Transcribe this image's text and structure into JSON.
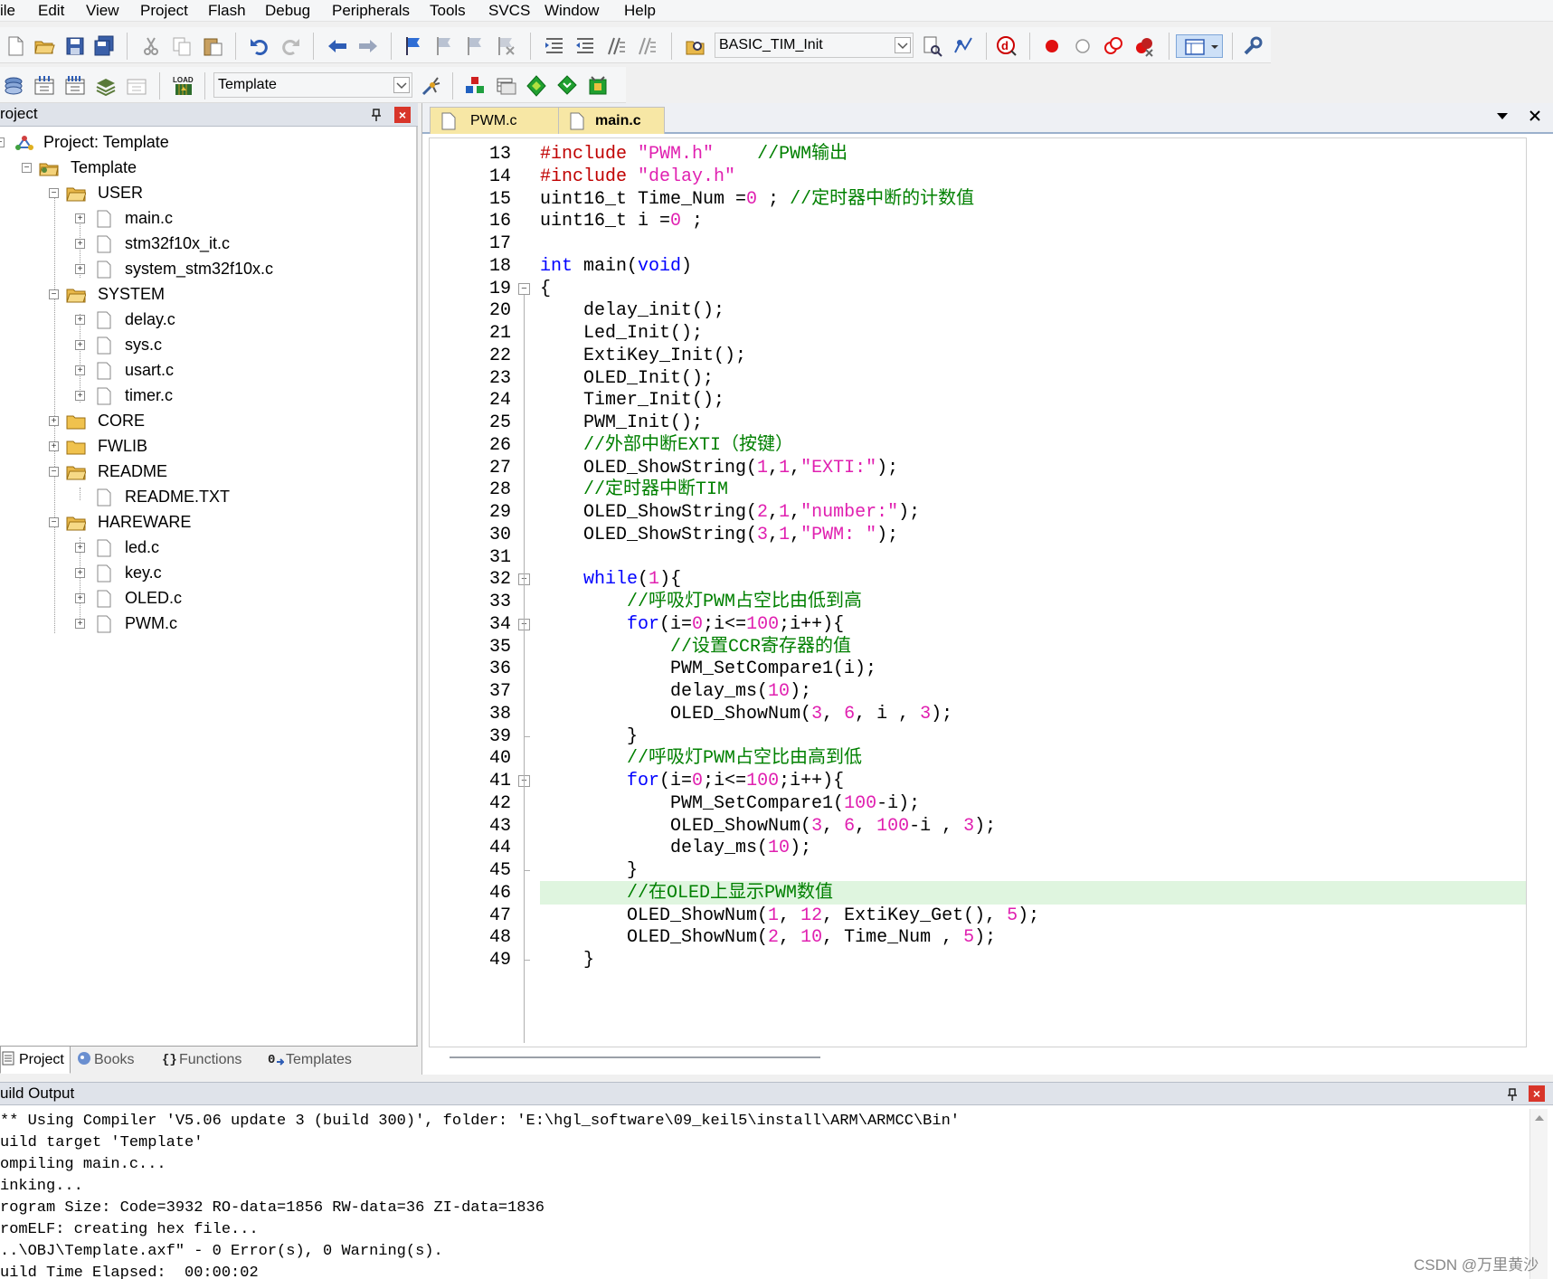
{
  "menu": [
    "ile",
    "Edit",
    "View",
    "Project",
    "Flash",
    "Debug",
    "Peripherals",
    "Tools",
    "SVCS",
    "Window",
    "Help"
  ],
  "toolbar1": {
    "target_combo": "BASIC_TIM_Init",
    "icons": [
      "new-file-icon",
      "open-folder-icon",
      "save-icon",
      "save-all-icon",
      "cut-icon",
      "copy-icon",
      "paste-icon",
      "undo-icon",
      "redo-icon",
      "nav-back-icon",
      "nav-forward-icon",
      "bookmark-icon",
      "prev-bookmark-icon",
      "next-bookmark-icon",
      "clear-bookmarks-icon",
      "indent-icon",
      "unindent-icon",
      "comment-icon",
      "uncomment-icon",
      "find-in-files-icon",
      "find-icon",
      "incremental-find-icon",
      "debug-session-icon",
      "breakpoint-icon",
      "disable-breakpoint-icon",
      "disable-all-breakpoints-icon",
      "kill-all-breakpoints-icon",
      "window-layout-icon",
      "configure-icon"
    ]
  },
  "toolbar2": {
    "target_select": "Template",
    "icons": [
      "translate-icon",
      "build-icon",
      "rebuild-icon",
      "batch-build-icon",
      "stop-build-icon",
      "download-icon",
      "target-options-icon",
      "manage-components-icon",
      "select-packs-icon",
      "pack-installer-icon",
      "manage-rte-icon",
      "environment-icon"
    ]
  },
  "project_panel": {
    "title": "roject",
    "tree": {
      "root": "Project: Template",
      "target": "Template",
      "groups": [
        {
          "name": "USER",
          "files": [
            "main.c",
            "stm32f10x_it.c",
            "system_stm32f10x.c"
          ]
        },
        {
          "name": "SYSTEM",
          "files": [
            "delay.c",
            "sys.c",
            "usart.c",
            "timer.c"
          ]
        },
        {
          "name": "CORE",
          "files": []
        },
        {
          "name": "FWLIB",
          "files": []
        },
        {
          "name": "README",
          "files": [
            "README.TXT"
          ]
        },
        {
          "name": "HAREWARE",
          "files": [
            "led.c",
            "key.c",
            "OLED.c",
            "PWM.c"
          ]
        }
      ]
    },
    "tabs": [
      "Project",
      "Books",
      "Functions",
      "Templates"
    ]
  },
  "editor": {
    "tabs": [
      "PWM.c",
      "main.c"
    ],
    "active_tab": "main.c",
    "highlight_line": 46,
    "lines": [
      {
        "n": "13",
        "fold": "",
        "segs": [
          [
            "pp",
            "#include "
          ],
          [
            "str",
            "\"PWM.h\""
          ],
          [
            "",
            "    "
          ],
          [
            "cm",
            "//PWM输出"
          ]
        ]
      },
      {
        "n": "14",
        "fold": "",
        "segs": [
          [
            "pp",
            "#include "
          ],
          [
            "str",
            "\"delay.h\""
          ]
        ]
      },
      {
        "n": "15",
        "fold": "",
        "segs": [
          [
            "",
            "uint16_t Time_Num ="
          ],
          [
            "num",
            "0"
          ],
          [
            "",
            " ; "
          ],
          [
            "cm",
            "//定时器中断的计数值"
          ]
        ]
      },
      {
        "n": "16",
        "fold": "",
        "segs": [
          [
            "",
            "uint16_t i ="
          ],
          [
            "num",
            "0"
          ],
          [
            "",
            " ;"
          ]
        ]
      },
      {
        "n": "17",
        "fold": "",
        "segs": []
      },
      {
        "n": "18",
        "fold": "",
        "segs": [
          [
            "kw",
            "int"
          ],
          [
            "",
            " main("
          ],
          [
            "kw",
            "void"
          ],
          [
            "",
            ")"
          ]
        ]
      },
      {
        "n": "19",
        "fold": "open",
        "segs": [
          [
            "",
            "{"
          ]
        ]
      },
      {
        "n": "20",
        "fold": "",
        "segs": [
          [
            "",
            "    delay_init();"
          ]
        ]
      },
      {
        "n": "21",
        "fold": "",
        "segs": [
          [
            "",
            "    Led_Init();"
          ]
        ]
      },
      {
        "n": "22",
        "fold": "",
        "segs": [
          [
            "",
            "    ExtiKey_Init();"
          ]
        ]
      },
      {
        "n": "23",
        "fold": "",
        "segs": [
          [
            "",
            "    OLED_Init();"
          ]
        ]
      },
      {
        "n": "24",
        "fold": "",
        "segs": [
          [
            "",
            "    Timer_Init();"
          ]
        ]
      },
      {
        "n": "25",
        "fold": "",
        "segs": [
          [
            "",
            "    PWM_Init();"
          ]
        ]
      },
      {
        "n": "26",
        "fold": "",
        "segs": [
          [
            "",
            "    "
          ],
          [
            "cm",
            "//外部中断EXTI（按键）"
          ]
        ]
      },
      {
        "n": "27",
        "fold": "",
        "segs": [
          [
            "",
            "    OLED_ShowString("
          ],
          [
            "num",
            "1"
          ],
          [
            "",
            ","
          ],
          [
            "num",
            "1"
          ],
          [
            "",
            ","
          ],
          [
            "str",
            "\"EXTI:\""
          ],
          [
            "",
            ");"
          ]
        ]
      },
      {
        "n": "28",
        "fold": "",
        "segs": [
          [
            "",
            "    "
          ],
          [
            "cm",
            "//定时器中断TIM"
          ]
        ]
      },
      {
        "n": "29",
        "fold": "",
        "segs": [
          [
            "",
            "    OLED_ShowString("
          ],
          [
            "num",
            "2"
          ],
          [
            "",
            ","
          ],
          [
            "num",
            "1"
          ],
          [
            "",
            ","
          ],
          [
            "str",
            "\"number:\""
          ],
          [
            "",
            ");"
          ]
        ]
      },
      {
        "n": "30",
        "fold": "",
        "segs": [
          [
            "",
            "    OLED_ShowString("
          ],
          [
            "num",
            "3"
          ],
          [
            "",
            ","
          ],
          [
            "num",
            "1"
          ],
          [
            "",
            ","
          ],
          [
            "str",
            "\"PWM: \""
          ],
          [
            "",
            ");"
          ]
        ]
      },
      {
        "n": "31",
        "fold": "",
        "segs": []
      },
      {
        "n": "32",
        "fold": "open",
        "segs": [
          [
            "",
            "    "
          ],
          [
            "kw",
            "while"
          ],
          [
            "",
            "("
          ],
          [
            "num",
            "1"
          ],
          [
            "",
            "){"
          ]
        ]
      },
      {
        "n": "33",
        "fold": "",
        "segs": [
          [
            "",
            "        "
          ],
          [
            "cm",
            "//呼吸灯PWM占空比由低到高"
          ]
        ]
      },
      {
        "n": "34",
        "fold": "open",
        "segs": [
          [
            "",
            "        "
          ],
          [
            "kw",
            "for"
          ],
          [
            "",
            "(i="
          ],
          [
            "num",
            "0"
          ],
          [
            "",
            ";i<="
          ],
          [
            "num",
            "100"
          ],
          [
            "",
            ";i++){"
          ]
        ]
      },
      {
        "n": "35",
        "fold": "",
        "segs": [
          [
            "",
            "            "
          ],
          [
            "cm",
            "//设置CCR寄存器的值"
          ]
        ]
      },
      {
        "n": "36",
        "fold": "",
        "segs": [
          [
            "",
            "            PWM_SetCompare1(i);"
          ]
        ]
      },
      {
        "n": "37",
        "fold": "",
        "segs": [
          [
            "",
            "            delay_ms("
          ],
          [
            "num",
            "10"
          ],
          [
            "",
            ");"
          ]
        ]
      },
      {
        "n": "38",
        "fold": "",
        "segs": [
          [
            "",
            "            OLED_ShowNum("
          ],
          [
            "num",
            "3"
          ],
          [
            "",
            ", "
          ],
          [
            "num",
            "6"
          ],
          [
            "",
            ", i , "
          ],
          [
            "num",
            "3"
          ],
          [
            "",
            ");"
          ]
        ]
      },
      {
        "n": "39",
        "fold": "end",
        "segs": [
          [
            "",
            "        }"
          ]
        ]
      },
      {
        "n": "40",
        "fold": "",
        "segs": [
          [
            "",
            "        "
          ],
          [
            "cm",
            "//呼吸灯PWM占空比由高到低"
          ]
        ]
      },
      {
        "n": "41",
        "fold": "open",
        "segs": [
          [
            "",
            "        "
          ],
          [
            "kw",
            "for"
          ],
          [
            "",
            "(i="
          ],
          [
            "num",
            "0"
          ],
          [
            "",
            ";i<="
          ],
          [
            "num",
            "100"
          ],
          [
            "",
            ";i++){"
          ]
        ]
      },
      {
        "n": "42",
        "fold": "",
        "segs": [
          [
            "",
            "            PWM_SetCompare1("
          ],
          [
            "num",
            "100"
          ],
          [
            "",
            "-i);"
          ]
        ]
      },
      {
        "n": "43",
        "fold": "",
        "segs": [
          [
            "",
            "            OLED_ShowNum("
          ],
          [
            "num",
            "3"
          ],
          [
            "",
            ", "
          ],
          [
            "num",
            "6"
          ],
          [
            "",
            ", "
          ],
          [
            "num",
            "100"
          ],
          [
            "",
            "-i , "
          ],
          [
            "num",
            "3"
          ],
          [
            "",
            ");"
          ]
        ]
      },
      {
        "n": "44",
        "fold": "",
        "segs": [
          [
            "",
            "            delay_ms("
          ],
          [
            "num",
            "10"
          ],
          [
            "",
            ");"
          ]
        ]
      },
      {
        "n": "45",
        "fold": "end",
        "segs": [
          [
            "",
            "        }"
          ]
        ]
      },
      {
        "n": "46",
        "fold": "",
        "segs": [
          [
            "",
            "        "
          ],
          [
            "cm",
            "//在OLED上显示PWM数值"
          ]
        ]
      },
      {
        "n": "47",
        "fold": "",
        "segs": [
          [
            "",
            "        OLED_ShowNum("
          ],
          [
            "num",
            "1"
          ],
          [
            "",
            ", "
          ],
          [
            "num",
            "12"
          ],
          [
            "",
            ", ExtiKey_Get(), "
          ],
          [
            "num",
            "5"
          ],
          [
            "",
            ");"
          ]
        ]
      },
      {
        "n": "48",
        "fold": "",
        "segs": [
          [
            "",
            "        OLED_ShowNum("
          ],
          [
            "num",
            "2"
          ],
          [
            "",
            ", "
          ],
          [
            "num",
            "10"
          ],
          [
            "",
            ", Time_Num , "
          ],
          [
            "num",
            "5"
          ],
          [
            "",
            ");"
          ]
        ]
      },
      {
        "n": "49",
        "fold": "end",
        "segs": [
          [
            "",
            "    }"
          ]
        ]
      }
    ]
  },
  "build_output": {
    "title": "uild Output",
    "lines": [
      "** Using Compiler 'V5.06 update 3 (build 300)', folder: 'E:\\hgl_software\\09_keil5\\install\\ARM\\ARMCC\\Bin'",
      "uild target 'Template'",
      "ompiling main.c...",
      "inking...",
      "rogram Size: Code=3932 RO-data=1856 RW-data=36 ZI-data=1836",
      "romELF: creating hex file...",
      "..\\OBJ\\Template.axf\" - 0 Error(s), 0 Warning(s).",
      "uild Time Elapsed:  00:00:02"
    ]
  },
  "watermark": "CSDN @万里黄沙",
  "colors": {
    "keyword": "#0000ff",
    "string_number": "#e020b0",
    "preprocessor": "#c00000",
    "comment": "#008000",
    "current_line": "#dff5df",
    "tab_active": "#f7e7a5"
  }
}
